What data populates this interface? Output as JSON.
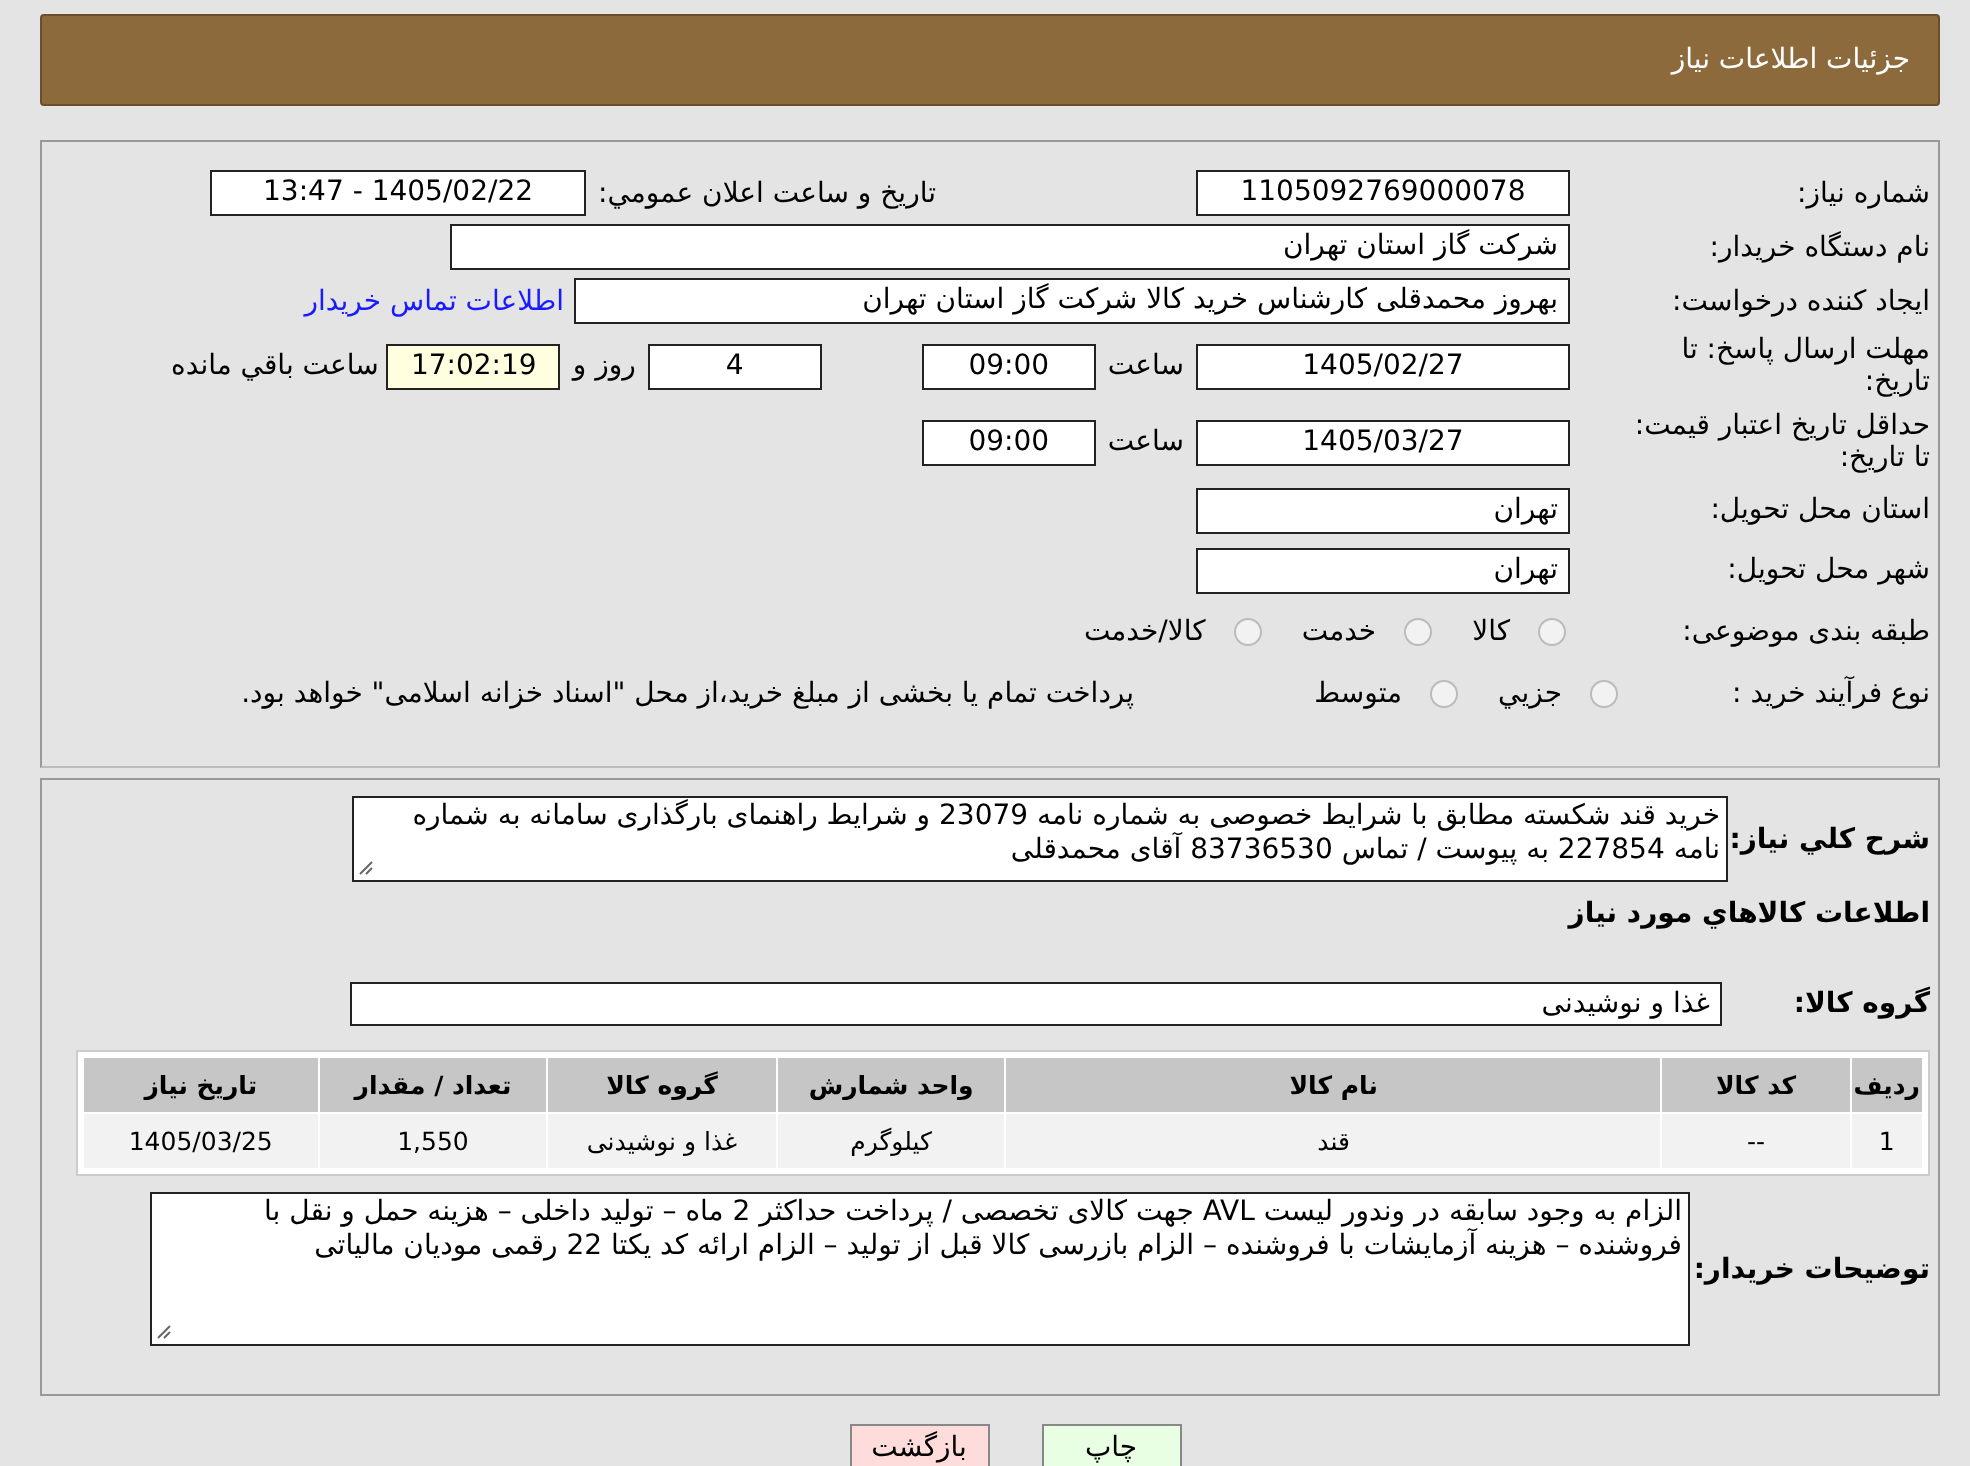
{
  "header": {
    "title": "جزئیات اطلاعات نیاز"
  },
  "details": {
    "need_number": {
      "label": "شماره نیاز:",
      "value": "1105092769000078"
    },
    "announce": {
      "label": "تاريخ و ساعت اعلان عمومي:",
      "value": "1405/02/22 - 13:47"
    },
    "buyer": {
      "label": "نام دستگاه خریدار:",
      "value": "شرکت گاز استان تهران"
    },
    "requester": {
      "label": "ایجاد کننده درخواست:",
      "value": "بهروز محمدقلی کارشناس خرید کالا شرکت گاز استان تهران",
      "link": "اطلاعات تماس خریدار"
    },
    "reply_deadline": {
      "label": "مهلت ارسال پاسخ: تا تاریخ:",
      "date": "1405/02/27",
      "time_label": "ساعت",
      "time": "09:00",
      "days": "4",
      "days_label": "روز و",
      "remaining": "17:02:19",
      "remaining_label": "ساعت باقي مانده"
    },
    "price_validity": {
      "label": "حداقل تاریخ اعتبار قیمت: تا تاریخ:",
      "date": "1405/03/27",
      "time_label": "ساعت",
      "time": "09:00"
    },
    "province": {
      "label": "استان محل تحویل:",
      "value": "تهران"
    },
    "city": {
      "label": "شهر محل تحویل:",
      "value": "تهران"
    },
    "category": {
      "label": "طبقه بندی موضوعی:",
      "options": [
        {
          "label": "کالا",
          "selected": false
        },
        {
          "label": "خدمت",
          "selected": false
        },
        {
          "label": "کالا/خدمت",
          "selected": false
        }
      ]
    },
    "process": {
      "label": "نوع فرآیند خرید :",
      "options": [
        {
          "label": "جزيي",
          "selected": false
        },
        {
          "label": "متوسط",
          "selected": false
        }
      ],
      "note": "پرداخت تمام یا بخشی از مبلغ خرید،از محل \"اسناد خزانه اسلامی\" خواهد بود."
    }
  },
  "description": {
    "label": "شرح کلي نياز:",
    "value": "خرید قند شکسته مطابق با شرایط خصوصی به شماره نامه 23079  و شرایط راهنمای بارگذاری سامانه به شماره نامه 227854 به پیوست  / تماس 83736530 آقای محمدقلی"
  },
  "goods": {
    "title": "اطلاعات کالاهاي مورد نياز",
    "group_label": "گروه کالا:",
    "group": "غذا و نوشیدنی",
    "table": {
      "columns": [
        "ردیف",
        "کد کالا",
        "نام کالا",
        "واحد شمارش",
        "گروه کالا",
        "تعداد / مقدار",
        "تاریخ نیاز"
      ],
      "rows": [
        [
          "1",
          "--",
          "قند",
          "کیلوگرم",
          "غذا و نوشیدنی",
          "1,550",
          "1405/03/25"
        ]
      ]
    }
  },
  "buyer_notes": {
    "label": "توضیحات خریدار:",
    "value": "الزام به وجود سابقه در وندور لیست AVL جهت کالای تخصصی / پرداخت حداکثر 2 ماه – تولید  داخلی – هزینه حمل و نقل با فروشنده – هزینه آزمایشات با فروشنده – الزام بازرسی کالا قبل از تولید – الزام ارائه  کد یکتا  22 رقمی مودیان مالیاتی"
  },
  "buttons": [
    {
      "label": "چاپ",
      "kind": "print"
    },
    {
      "label": "بازگشت",
      "kind": "back"
    }
  ]
}
